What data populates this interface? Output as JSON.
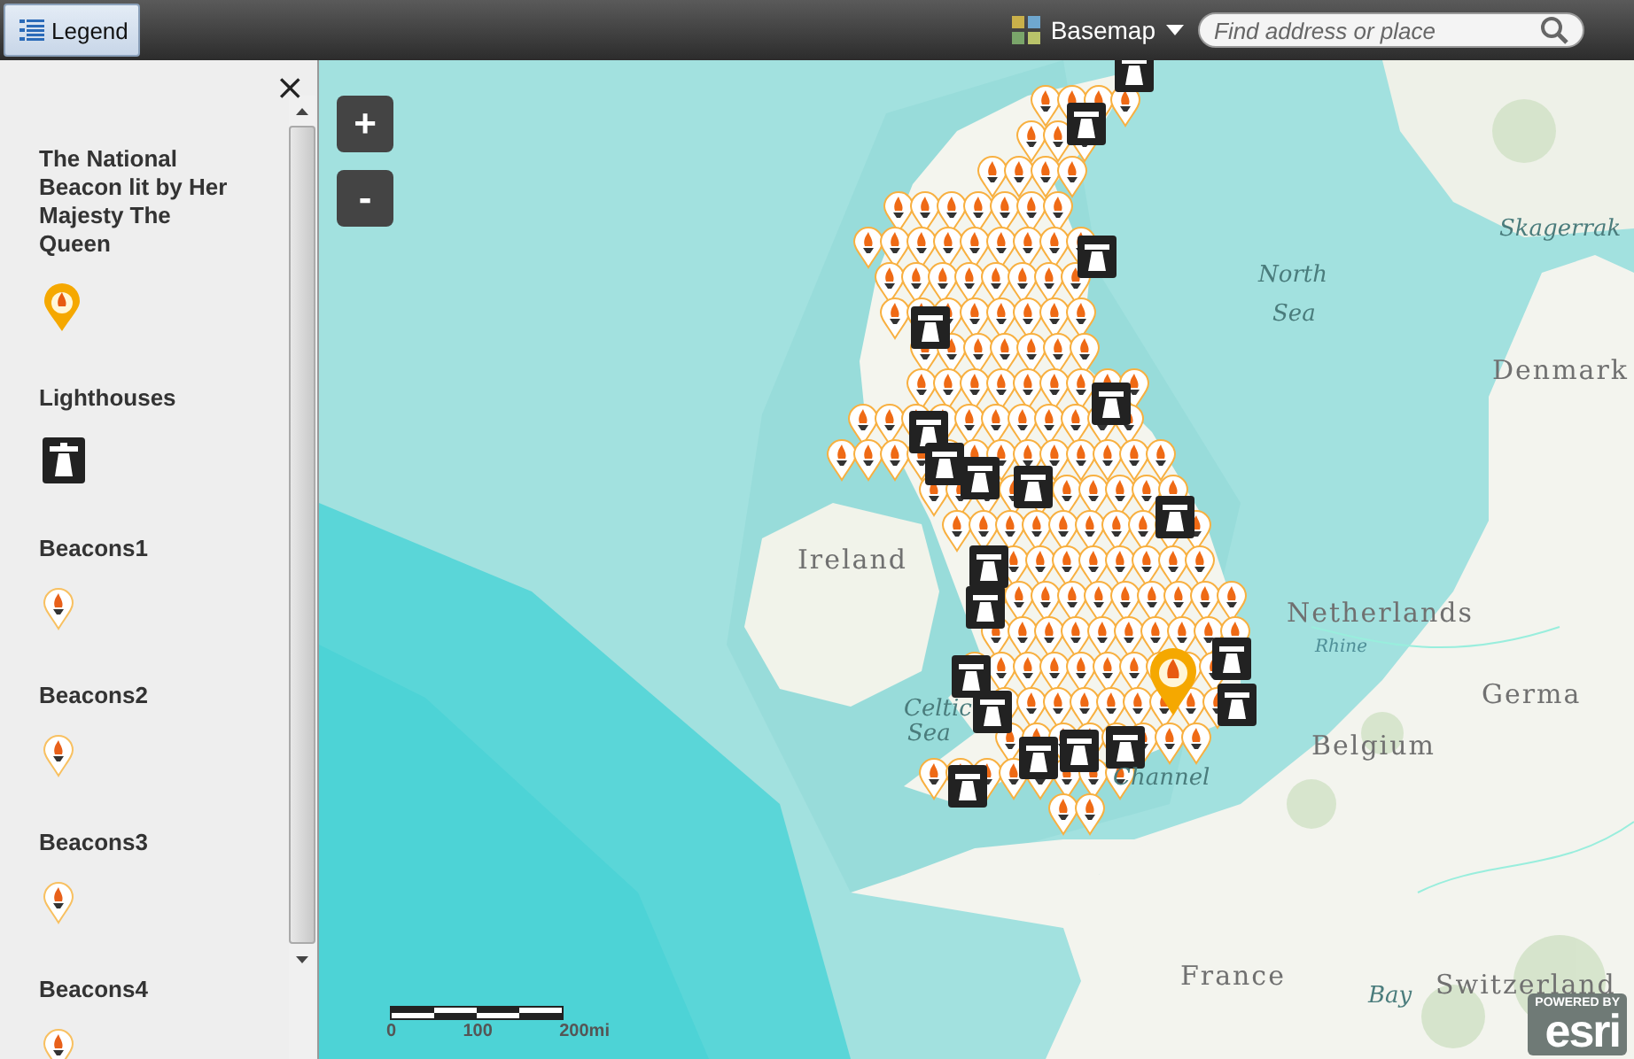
{
  "toolbar": {
    "legend_button": "Legend",
    "basemap_button": "Basemap",
    "search": {
      "placeholder": "Find address or place"
    }
  },
  "legend": {
    "close": "×",
    "items": [
      {
        "label": "The National Beacon lit by Her Majesty The Queen",
        "kind": "national"
      },
      {
        "label": "Lighthouses",
        "kind": "lighthouse"
      },
      {
        "label": "Beacons1",
        "kind": "beacon"
      },
      {
        "label": "Beacons2",
        "kind": "beacon"
      },
      {
        "label": "Beacons3",
        "kind": "beacon"
      },
      {
        "label": "Beacons4",
        "kind": "beacon"
      }
    ]
  },
  "map": {
    "zoom_in": "+",
    "zoom_out": "-",
    "labels": [
      {
        "text": "Skagerrak",
        "kind": "sea"
      },
      {
        "text": "North",
        "kind": "sea"
      },
      {
        "text": "Sea",
        "kind": "sea"
      },
      {
        "text": "Denmark",
        "kind": "country"
      },
      {
        "text": "Ireland",
        "kind": "country"
      },
      {
        "text": "Netherlands",
        "kind": "country"
      },
      {
        "text": "Rhine",
        "kind": "river"
      },
      {
        "text": "Celtic",
        "kind": "sea"
      },
      {
        "text": "Germa",
        "kind": "country"
      },
      {
        "text": "Sea",
        "kind": "sea"
      },
      {
        "text": "Belgium",
        "kind": "country"
      },
      {
        "text": "Channel",
        "kind": "sea"
      },
      {
        "text": "France",
        "kind": "country"
      },
      {
        "text": "Bay",
        "kind": "sea"
      },
      {
        "text": "Switzerland",
        "kind": "country"
      }
    ],
    "scale": {
      "ticks": [
        "0",
        "100",
        "200mi"
      ]
    },
    "attribution": {
      "powered_by": "POWERED BY",
      "logo": "esri"
    }
  }
}
